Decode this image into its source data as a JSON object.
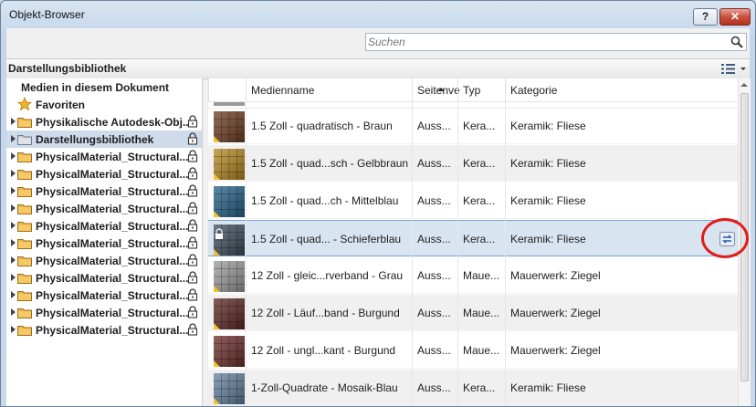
{
  "window": {
    "title": "Objekt-Browser",
    "help_label": "?",
    "close_label": "✕"
  },
  "search": {
    "placeholder": "Suchen",
    "value": ""
  },
  "library_header": {
    "title": "Darstellungsbibliothek",
    "view_icon": "list-view-icon"
  },
  "tree": {
    "items": [
      {
        "label": "Medien in diesem Dokument",
        "type": "header",
        "selected": false
      },
      {
        "label": "Favoriten",
        "type": "favorite",
        "selected": false
      },
      {
        "label": "Physikalische Autodesk-Obj...",
        "type": "folder",
        "locked": true,
        "selected": false
      },
      {
        "label": "Darstellungsbibliothek",
        "type": "folder",
        "locked": true,
        "selected": true
      },
      {
        "label": "PhysicalMaterial_Structural...",
        "type": "folder",
        "locked": true,
        "selected": false
      },
      {
        "label": "PhysicalMaterial_Structural...",
        "type": "folder",
        "locked": true,
        "selected": false
      },
      {
        "label": "PhysicalMaterial_Structural...",
        "type": "folder",
        "locked": true,
        "selected": false
      },
      {
        "label": "PhysicalMaterial_Structural...",
        "type": "folder",
        "locked": true,
        "selected": false
      },
      {
        "label": "PhysicalMaterial_Structural...",
        "type": "folder",
        "locked": true,
        "selected": false
      },
      {
        "label": "PhysicalMaterial_Structural...",
        "type": "folder",
        "locked": true,
        "selected": false
      },
      {
        "label": "PhysicalMaterial_Structural...",
        "type": "folder",
        "locked": true,
        "selected": false
      },
      {
        "label": "PhysicalMaterial_Structural...",
        "type": "folder",
        "locked": true,
        "selected": false
      },
      {
        "label": "PhysicalMaterial_Structural...",
        "type": "folder",
        "locked": true,
        "selected": false
      },
      {
        "label": "PhysicalMaterial_Structural...",
        "type": "folder",
        "locked": true,
        "selected": false
      },
      {
        "label": "PhysicalMaterial_Structural...",
        "type": "folder",
        "locked": true,
        "selected": false
      }
    ]
  },
  "table": {
    "columns": [
      "Medienname",
      "Seitenve",
      "Typ",
      "Kategorie"
    ],
    "sort_column": "Medienname",
    "rows": [
      {
        "name": "1.5 Zoll - quadratisch - Braun",
        "seite": "Auss...",
        "typ": "Kera...",
        "kategorie": "Keramik: Fliese",
        "color": "#6b3a1e",
        "selected": false
      },
      {
        "name": "1.5 Zoll - quad...sch - Gelbbraun",
        "seite": "Auss...",
        "typ": "Kera...",
        "kategorie": "Keramik: Fliese",
        "color": "#b5861c",
        "selected": false
      },
      {
        "name": "1.5 Zoll - quad...ch - Mittelblau",
        "seite": "Auss...",
        "typ": "Kera...",
        "kategorie": "Keramik: Fliese",
        "color": "#1f5f86",
        "selected": false
      },
      {
        "name": "1.5 Zoll - quad... - Schieferblau",
        "seite": "Auss...",
        "typ": "Kera...",
        "kategorie": "Keramik: Fliese",
        "color": "#3b4a58",
        "selected": true
      },
      {
        "name": "12 Zoll - gleic...rverband - Grau",
        "seite": "Auss...",
        "typ": "Maue...",
        "kategorie": "Mauerwerk: Ziegel",
        "color": "#9a9a9a",
        "selected": false
      },
      {
        "name": "12 Zoll - Läuf...band - Burgund",
        "seite": "Auss...",
        "typ": "Maue...",
        "kategorie": "Mauerwerk: Ziegel",
        "color": "#5a2420",
        "selected": false
      },
      {
        "name": "12 Zoll - ungl...kant - Burgund",
        "seite": "Auss...",
        "typ": "Maue...",
        "kategorie": "Mauerwerk: Ziegel",
        "color": "#6a2a26",
        "selected": false
      },
      {
        "name": "1-Zoll-Quadrate - Mosaik-Blau",
        "seite": "Auss...",
        "typ": "Kera...",
        "kategorie": "Keramik: Fliese",
        "color": "#5f7e9a",
        "selected": false
      }
    ]
  },
  "icons": {
    "search": "search-icon",
    "lock": "lock-icon",
    "folder": "folder-icon",
    "star": "star-icon",
    "replace": "replace-icon"
  }
}
